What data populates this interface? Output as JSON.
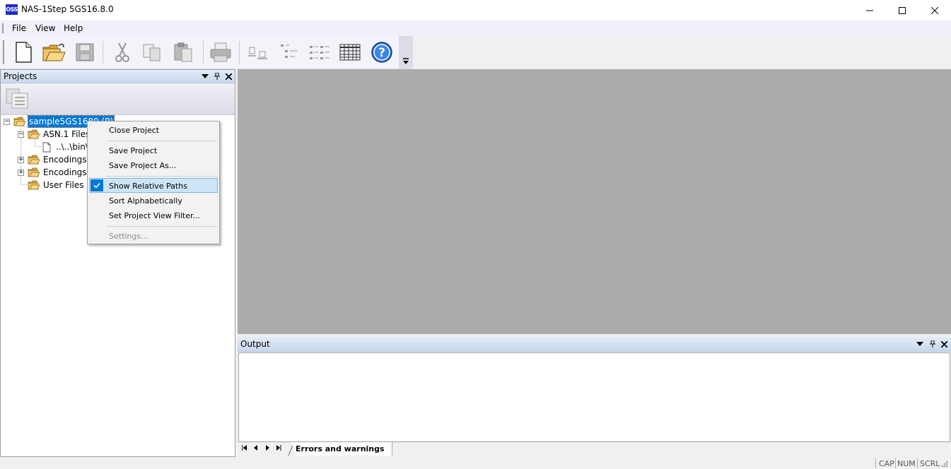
{
  "window": {
    "app_icon_text": "OSS",
    "title": "NAS-1Step 5GS16.8.0"
  },
  "menu": {
    "items": [
      "File",
      "View",
      "Help"
    ]
  },
  "toolbar": {
    "buttons": [
      "new-document-icon",
      "open-folder-icon",
      "save-icon",
      "cut-icon",
      "copy-icon",
      "paste-icon",
      "print-icon",
      "properties-icon",
      "tree-icon",
      "list-icon",
      "table-icon",
      "help-icon"
    ]
  },
  "projects": {
    "title": "Projects",
    "tree": {
      "root": "sample5GS1680 (P)",
      "asn_files": "ASN.1 Files",
      "asn_file_path": "..\\..\\bin\\",
      "encodings_1": "Encodings -",
      "encodings_2": "Encodings -",
      "user_files": "User Files"
    }
  },
  "context_menu": {
    "close_project": "Close Project",
    "save_project": "Save Project",
    "save_project_as": "Save Project As...",
    "show_relative_paths": "Show Relative Paths",
    "show_relative_paths_checked": true,
    "sort_alphabetically": "Sort Alphabetically",
    "set_project_view_filter": "Set Project View Filter...",
    "settings": "Settings..."
  },
  "output": {
    "title": "Output",
    "active_tab": "Errors and warnings"
  },
  "status": {
    "cap": "CAP",
    "num": "NUM",
    "scrl": "SCRL"
  },
  "colors": {
    "selection": "#0078d7",
    "panel_header": "#c8d7ed",
    "main_area": "#ababab"
  }
}
